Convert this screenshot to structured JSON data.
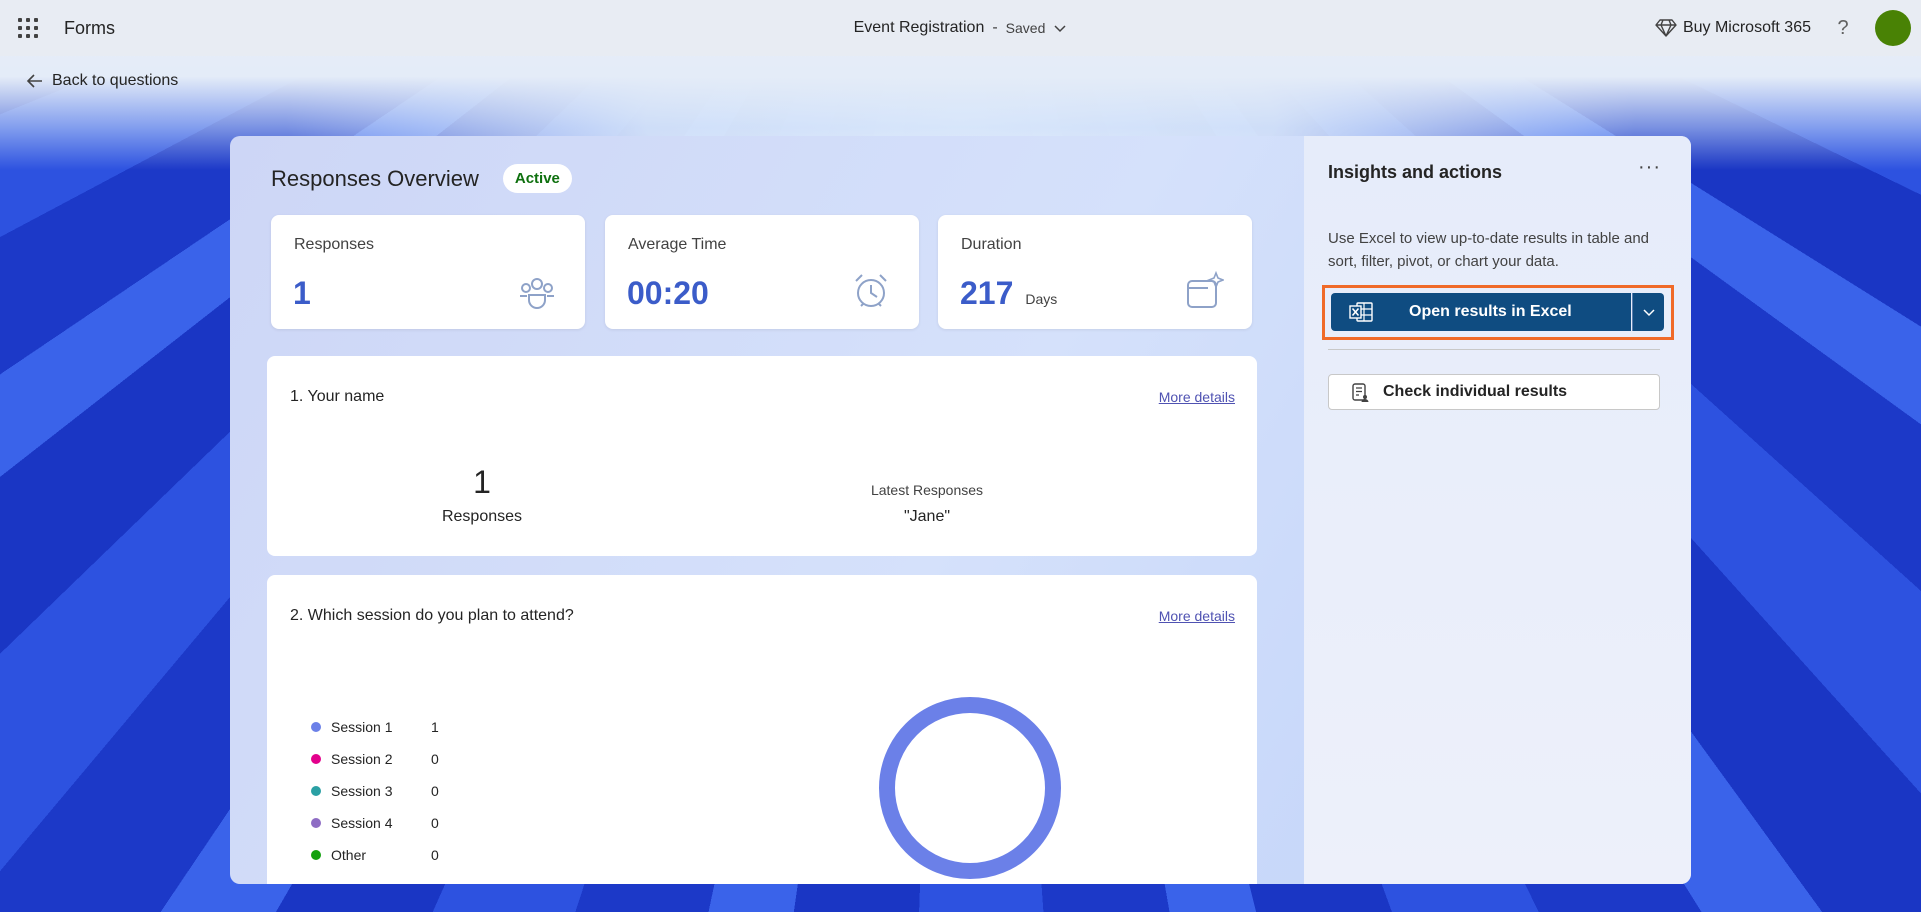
{
  "header": {
    "app_name": "Forms",
    "doc_title": "Event Registration",
    "separator": "-",
    "save_status": "Saved",
    "buy_label": "Buy Microsoft 365",
    "help_label": "?"
  },
  "nav": {
    "back_label": "Back to questions"
  },
  "overview": {
    "title": "Responses Overview",
    "status": "Active",
    "stats": [
      {
        "label": "Responses",
        "value": "1",
        "icon": "people-icon"
      },
      {
        "label": "Average Time",
        "value": "00:20",
        "icon": "alarm-clock-icon"
      },
      {
        "label": "Duration",
        "value": "217",
        "unit": "Days",
        "icon": "calendar-sparkle-icon"
      }
    ]
  },
  "questions": [
    {
      "title": "1. Your name",
      "more_label": "More details",
      "count": "1",
      "count_label": "Responses",
      "latest_label": "Latest Responses",
      "latest_value": "\"Jane\""
    },
    {
      "title": "2. Which session do you plan to attend?",
      "more_label": "More details",
      "options": [
        {
          "name": "Session 1",
          "count": "1",
          "color": "#6b80e8"
        },
        {
          "name": "Session 2",
          "count": "0",
          "color": "#e3008c"
        },
        {
          "name": "Session 3",
          "count": "0",
          "color": "#2aa0a4"
        },
        {
          "name": "Session 4",
          "count": "0",
          "color": "#8e6cc4"
        },
        {
          "name": "Other",
          "count": "0",
          "color": "#13a10e"
        }
      ]
    }
  ],
  "chart_data": {
    "type": "pie",
    "categories": [
      "Session 1",
      "Session 2",
      "Session 3",
      "Session 4",
      "Other"
    ],
    "values": [
      1,
      0,
      0,
      0,
      0
    ],
    "title": "",
    "donut": true
  },
  "insights": {
    "title": "Insights and actions",
    "more_label": "···",
    "description": "Use Excel to view up-to-date results in table and sort, filter, pivot, or chart your data.",
    "excel_button": "Open results in Excel",
    "check_button": "Check individual results"
  },
  "colors": {
    "accent": "#3b5cc9",
    "excel_button": "#0f4c81",
    "highlight_border": "#f06a28",
    "active_badge": "#0e700e",
    "avatar": "#498205"
  }
}
